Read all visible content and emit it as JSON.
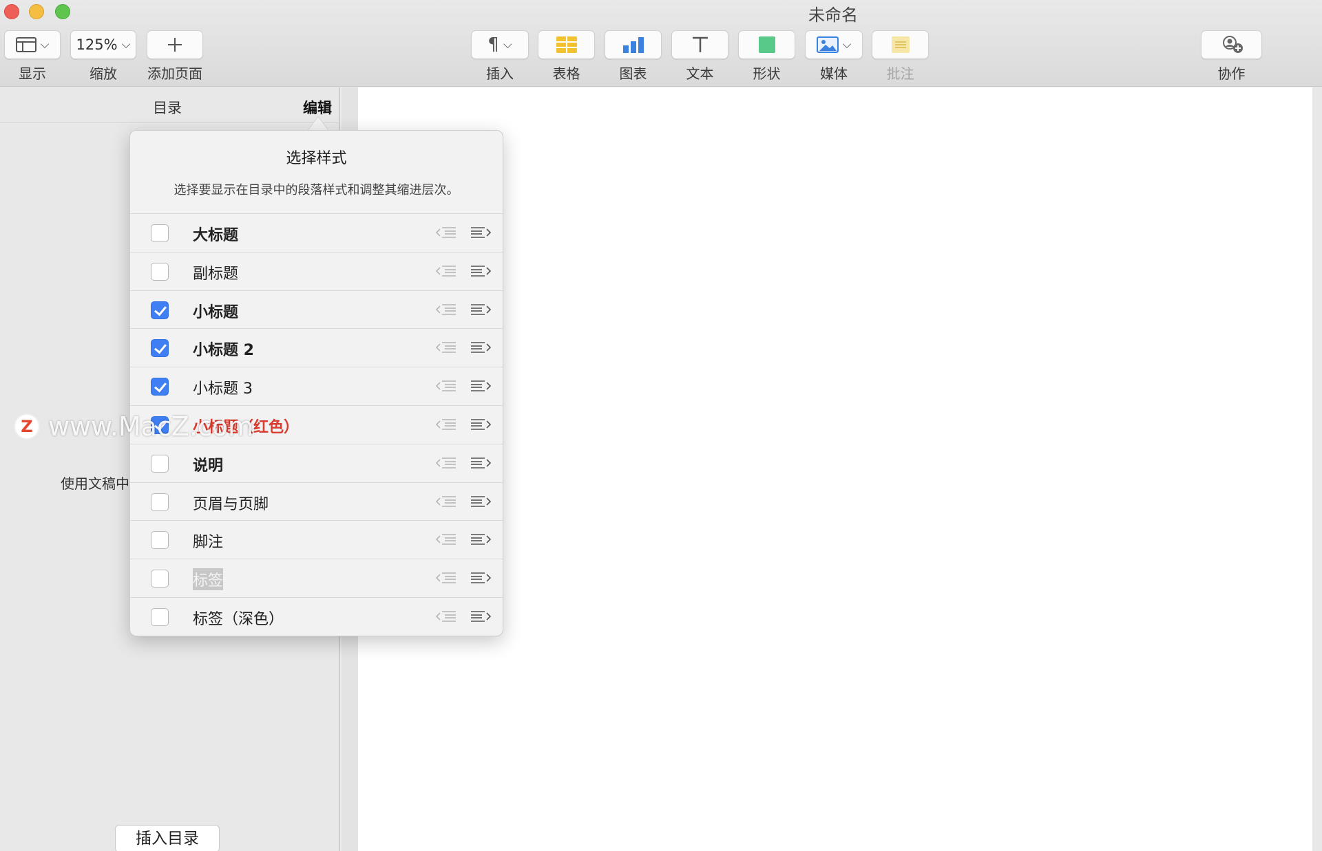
{
  "window": {
    "title": "未命名"
  },
  "toolbar": {
    "view": {
      "label": "显示",
      "icon": "sidebar-view-icon"
    },
    "zoom": {
      "label": "缩放",
      "value": "125%"
    },
    "add_page": {
      "label": "添加页面",
      "icon": "plus-icon"
    },
    "insert": {
      "label": "插入",
      "icon": "paragraph-icon"
    },
    "table": {
      "label": "表格",
      "icon": "table-icon"
    },
    "chart": {
      "label": "图表",
      "icon": "chart-icon"
    },
    "text": {
      "label": "文本",
      "icon": "text-icon"
    },
    "shape": {
      "label": "形状",
      "icon": "shape-icon"
    },
    "media": {
      "label": "媒体",
      "icon": "media-icon"
    },
    "comment": {
      "label": "批注",
      "icon": "comment-icon"
    },
    "collaborate": {
      "label": "协作",
      "icon": "collaborate-icon"
    },
    "colors": {
      "table": "#f2c12e",
      "chart": "#3b82e0",
      "shape": "#59c98a",
      "media": "#3b82e0",
      "comment": "#f3d46b"
    }
  },
  "sidebar": {
    "tabs": {
      "toc": "目录",
      "edit": "编辑"
    },
    "hint": "使用文稿中",
    "insert_toc_button": "插入目录"
  },
  "popover": {
    "title": "选择样式",
    "description": "选择要显示在目录中的段落样式和调整其缩进层次。",
    "styles": [
      {
        "label": "大标题",
        "checked": false
      },
      {
        "label": "副标题",
        "checked": false
      },
      {
        "label": "小标题",
        "checked": true
      },
      {
        "label": "小标题 2",
        "checked": true
      },
      {
        "label": "小标题 3",
        "checked": true
      },
      {
        "label": "小标题（红色）",
        "checked": true
      },
      {
        "label": "说明",
        "checked": false
      },
      {
        "label": "页眉与页脚",
        "checked": false
      },
      {
        "label": "脚注",
        "checked": false
      },
      {
        "label": "标签",
        "checked": false
      },
      {
        "label": "标签（深色）",
        "checked": false
      }
    ]
  },
  "watermark": {
    "badge": "Z",
    "text": "www.MacZ.com"
  }
}
